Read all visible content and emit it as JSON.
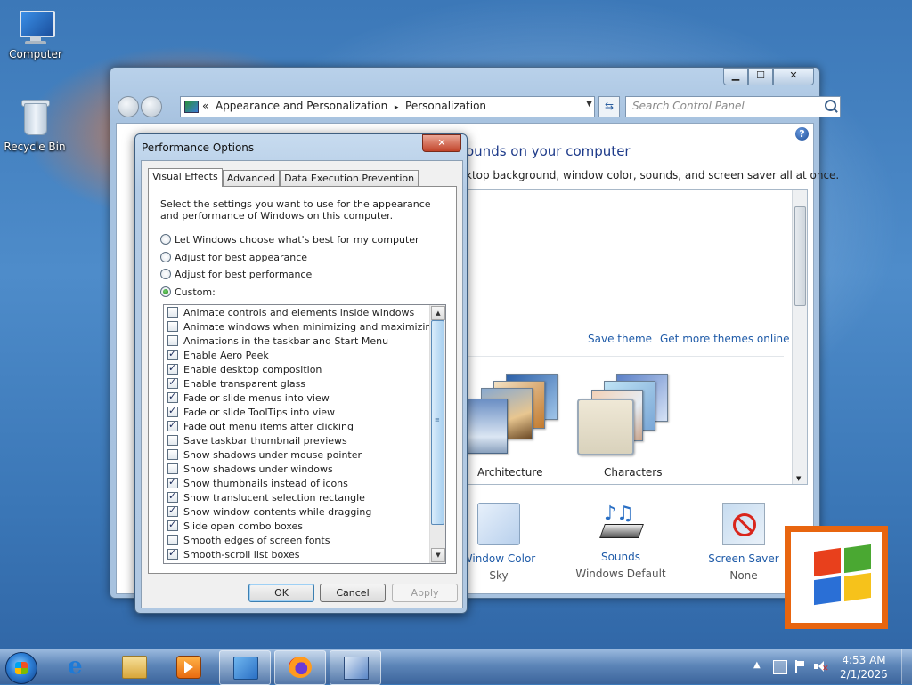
{
  "desktop": {
    "icons": [
      {
        "label": "Computer"
      },
      {
        "label": "Recycle Bin"
      }
    ]
  },
  "control_panel": {
    "breadcrumb": [
      "«",
      "Appearance and Personalization",
      "▸",
      "Personalization"
    ],
    "search_placeholder": "Search Control Panel",
    "heading": "ounds on your computer",
    "subheading": "ktop background, window color, sounds, and screen saver all at once.",
    "links": {
      "save_theme": "Save theme",
      "get_more_themes": "Get more themes online"
    },
    "themes": [
      {
        "name": "Architecture"
      },
      {
        "name": "Characters"
      }
    ],
    "bottom": [
      {
        "label": "Window Color",
        "value": "Sky"
      },
      {
        "label": "Sounds",
        "value": "Windows Default"
      },
      {
        "label": "Screen Saver",
        "value": "None"
      }
    ],
    "caption": {
      "minimize": "▁",
      "maximize": "☐",
      "close": "✕"
    }
  },
  "performance_options": {
    "title": "Performance Options",
    "tabs": [
      "Visual Effects",
      "Advanced",
      "Data Execution Prevention"
    ],
    "active_tab": "Visual Effects",
    "description": "Select the settings you want to use for the appearance and performance of Windows on this computer.",
    "radios": [
      {
        "label": "Let Windows choose what's best for my computer",
        "checked": false
      },
      {
        "label": "Adjust for best appearance",
        "checked": false
      },
      {
        "label": "Adjust for best performance",
        "checked": false
      },
      {
        "label": "Custom:",
        "checked": true
      }
    ],
    "options": [
      {
        "label": "Animate controls and elements inside windows",
        "checked": false
      },
      {
        "label": "Animate windows when minimizing and maximizing",
        "checked": false
      },
      {
        "label": "Animations in the taskbar and Start Menu",
        "checked": false
      },
      {
        "label": "Enable Aero Peek",
        "checked": true
      },
      {
        "label": "Enable desktop composition",
        "checked": true
      },
      {
        "label": "Enable transparent glass",
        "checked": true
      },
      {
        "label": "Fade or slide menus into view",
        "checked": true
      },
      {
        "label": "Fade or slide ToolTips into view",
        "checked": true
      },
      {
        "label": "Fade out menu items after clicking",
        "checked": true
      },
      {
        "label": "Save taskbar thumbnail previews",
        "checked": false
      },
      {
        "label": "Show shadows under mouse pointer",
        "checked": false
      },
      {
        "label": "Show shadows under windows",
        "checked": false
      },
      {
        "label": "Show thumbnails instead of icons",
        "checked": true
      },
      {
        "label": "Show translucent selection rectangle",
        "checked": true
      },
      {
        "label": "Show window contents while dragging",
        "checked": true
      },
      {
        "label": "Slide open combo boxes",
        "checked": true
      },
      {
        "label": "Smooth edges of screen fonts",
        "checked": false
      },
      {
        "label": "Smooth-scroll list boxes",
        "checked": true
      }
    ],
    "buttons": {
      "ok": "OK",
      "cancel": "Cancel",
      "apply": "Apply"
    },
    "close": "✕"
  },
  "taskbar": {
    "items": [
      "internet-explorer-icon",
      "windows-explorer-icon",
      "media-player-icon",
      "control-panel-icon",
      "firefox-icon",
      "system-properties-icon"
    ],
    "clock": {
      "time": "4:53 AM",
      "date": "2/1/2025"
    },
    "tray_arrow": "▲"
  }
}
